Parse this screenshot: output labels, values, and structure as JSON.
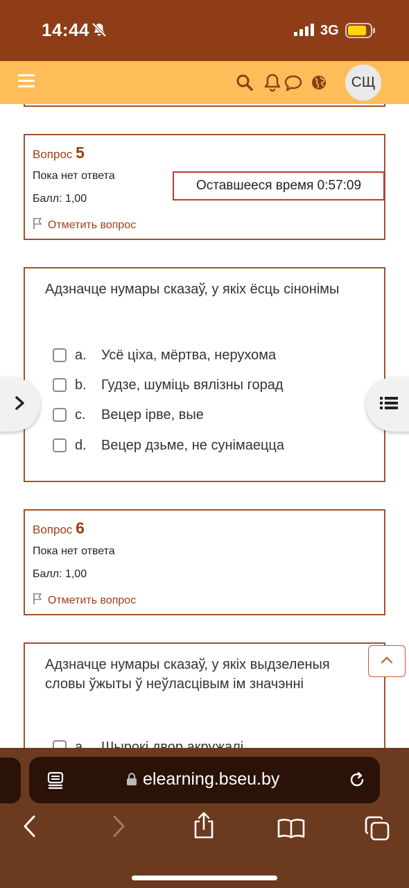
{
  "status_bar": {
    "time": "14:44",
    "network": "3G"
  },
  "header": {
    "avatar_initials": "СЩ"
  },
  "questions": [
    {
      "label": "Вопрос",
      "number": "5",
      "state": "Пока нет ответа",
      "grade": "Балл: 1,00",
      "flag_label": "Отметить вопрос",
      "text": "Адзначце нумары сказаў, у якіх ёсць сінонімы",
      "options": [
        {
          "letter": "a.",
          "text": "Усё ціха, мёртва, нерухома"
        },
        {
          "letter": "b.",
          "text": "Гудзе, шуміць вялізны горад"
        },
        {
          "letter": "c.",
          "text": "Вецер ірве, вые"
        },
        {
          "letter": "d.",
          "text": "Вецер дзьме, не сунімаецца"
        }
      ]
    },
    {
      "label": "Вопрос",
      "number": "6",
      "state": "Пока нет ответа",
      "grade": "Балл: 1,00",
      "flag_label": "Отметить вопрос",
      "text": "Адзначце нумары сказаў, у якіх выдзеленыя словы ўжыты ў неўласцівым ім значэнні",
      "options": [
        {
          "letter": "a.",
          "text": "Шырокі двор акружалі"
        }
      ]
    }
  ],
  "timer": {
    "text": "Оставшееся время 0:57:09"
  },
  "browser": {
    "url": "elearning.bseu.by"
  },
  "colors": {
    "status_bar": "#8f3d16",
    "navbar": "#ffbd59",
    "accent": "#9b3f14",
    "box_border": "#a0512a",
    "timer_border": "#c0392b"
  }
}
